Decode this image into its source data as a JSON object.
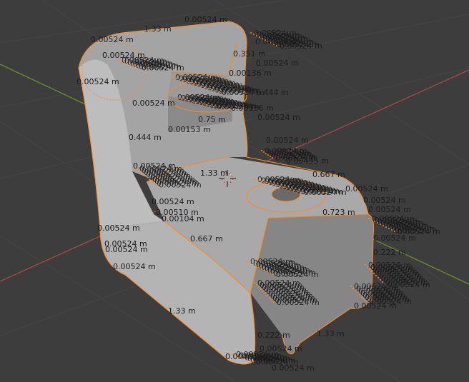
{
  "viewport": {
    "colors": {
      "background": "#3d3d3d",
      "grid": "#444444",
      "x_axis": "#a8474f",
      "y_axis": "#6e8c2a",
      "mesh_face_light": "#b7b7b7",
      "mesh_face_mid": "#9c9c9c",
      "mesh_face_dark": "#7f7f7f",
      "selected_edge": "#ff8a1a",
      "label": "#1c1c1c"
    },
    "cursor_icon": "3d-cursor-icon",
    "measurements": [
      {
        "id": "m1",
        "text": "0.00524 m"
      },
      {
        "id": "m2",
        "text": "1.33 m"
      },
      {
        "id": "m3",
        "text": "0.00524 m"
      },
      {
        "id": "m4",
        "text": "0.00524 m"
      },
      {
        "id": "m5",
        "text": "0.00524 m"
      },
      {
        "id": "m6",
        "text": "0.351 m"
      },
      {
        "id": "m7",
        "text": "0.00524 m"
      },
      {
        "id": "m8",
        "text": "0.00524 m"
      },
      {
        "id": "m9",
        "text": "0.00136 m"
      },
      {
        "id": "m10",
        "text": "0.00524 m"
      },
      {
        "id": "m11",
        "text": "0.444 m"
      },
      {
        "id": "m12",
        "text": "0.00136 m"
      },
      {
        "id": "m13",
        "text": "0.00524 m"
      },
      {
        "id": "m14",
        "text": "0.75 m"
      },
      {
        "id": "m15",
        "text": "0.00153 m"
      },
      {
        "id": "m16",
        "text": "0.444 m"
      },
      {
        "id": "m17",
        "text": "0.00524 m"
      },
      {
        "id": "m18",
        "text": "0.00495 m"
      },
      {
        "id": "m19",
        "text": "1.33 m"
      },
      {
        "id": "m20",
        "text": "0.667 m"
      },
      {
        "id": "m21",
        "text": "0.00524 m"
      },
      {
        "id": "m22",
        "text": "0.00524 m"
      },
      {
        "id": "m23",
        "text": "0.00524 m"
      },
      {
        "id": "m24",
        "text": "0.723 m"
      },
      {
        "id": "m25",
        "text": "0.00524 m"
      },
      {
        "id": "m26",
        "text": "0.00524 m"
      },
      {
        "id": "m27",
        "text": "0.00510 m"
      },
      {
        "id": "m28",
        "text": "0.00104 m"
      },
      {
        "id": "m29",
        "text": "0.00524 m"
      },
      {
        "id": "m30",
        "text": "0.667 m"
      },
      {
        "id": "m31",
        "text": "0.00524 m"
      },
      {
        "id": "m32",
        "text": "0.00524 m"
      },
      {
        "id": "m33",
        "text": "0.00524 m"
      },
      {
        "id": "m34",
        "text": "0.222 m"
      },
      {
        "id": "m35",
        "text": "0.00524 m"
      },
      {
        "id": "m36",
        "text": "1.33 m"
      },
      {
        "id": "m37",
        "text": "0.222 m"
      },
      {
        "id": "m38",
        "text": "1.33 m"
      },
      {
        "id": "m39",
        "text": "0.00495 m"
      },
      {
        "id": "m40",
        "text": "0.00524 m"
      },
      {
        "id": "m41",
        "text": "0.00524 m"
      },
      {
        "id": "m42",
        "text": "0.00524 m"
      }
    ],
    "clutter_label": "0.00524 m"
  }
}
